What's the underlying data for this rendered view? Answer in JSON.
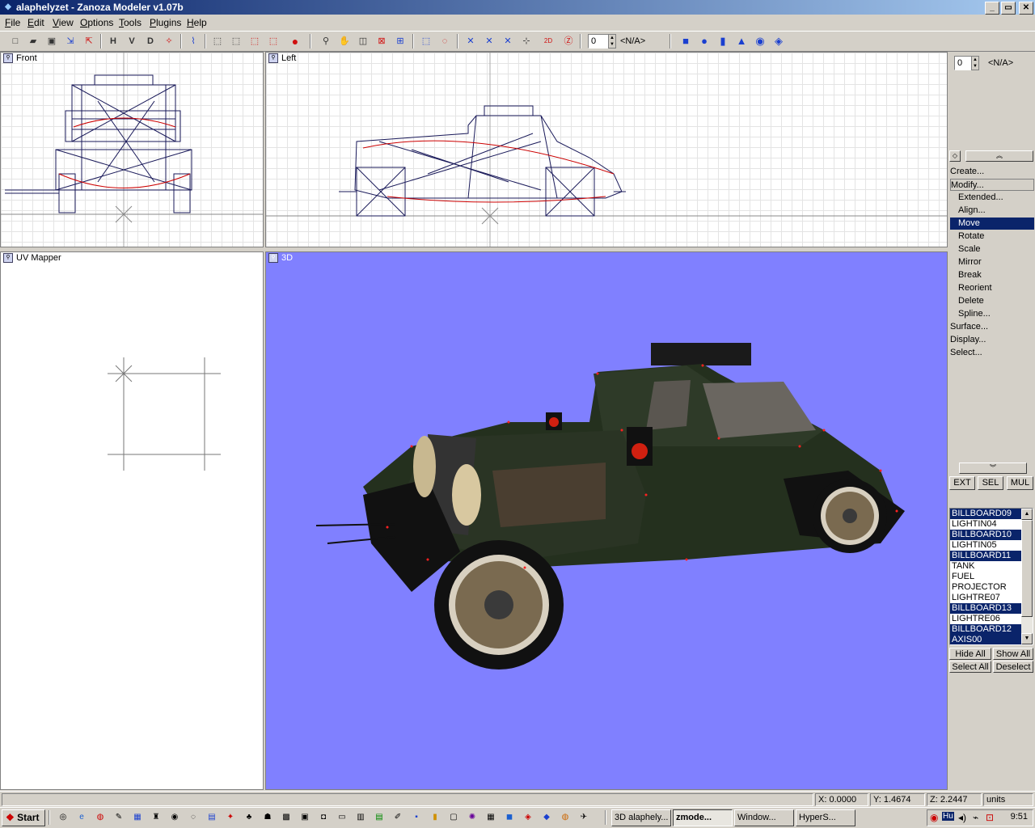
{
  "window": {
    "title": "alaphelyzet - Zanoza Modeler v1.07b",
    "min": "_",
    "max": "▭",
    "close": "✕"
  },
  "menu": [
    "File",
    "Edit",
    "View",
    "Options",
    "Tools",
    "Plugins",
    "Help"
  ],
  "toolbar": {
    "h_label": "H",
    "v_label": "V",
    "d_label": "D",
    "spin_value": "0",
    "nav_value": "<N/A>"
  },
  "viewports": {
    "front": "Front",
    "left": "Left",
    "uv": "UV Mapper",
    "persp": "3D"
  },
  "right_panel": {
    "spin_value": "0",
    "nav_value": "<N/A>",
    "menu": [
      {
        "label": "Create...",
        "sub": false,
        "sel": false,
        "boxed": false
      },
      {
        "label": "Modify...",
        "sub": false,
        "sel": false,
        "boxed": true
      },
      {
        "label": "Extended...",
        "sub": true,
        "sel": false,
        "boxed": false
      },
      {
        "label": "Align...",
        "sub": true,
        "sel": false,
        "boxed": false
      },
      {
        "label": "Move",
        "sub": true,
        "sel": true,
        "boxed": false
      },
      {
        "label": "Rotate",
        "sub": true,
        "sel": false,
        "boxed": false
      },
      {
        "label": "Scale",
        "sub": true,
        "sel": false,
        "boxed": false
      },
      {
        "label": "Mirror",
        "sub": true,
        "sel": false,
        "boxed": false
      },
      {
        "label": "Break",
        "sub": true,
        "sel": false,
        "boxed": false
      },
      {
        "label": "Reorient",
        "sub": true,
        "sel": false,
        "boxed": false
      },
      {
        "label": "Delete",
        "sub": true,
        "sel": false,
        "boxed": false
      },
      {
        "label": "Spline...",
        "sub": true,
        "sel": false,
        "boxed": false
      },
      {
        "label": "Surface...",
        "sub": false,
        "sel": false,
        "boxed": false
      },
      {
        "label": "Display...",
        "sub": false,
        "sel": false,
        "boxed": false
      },
      {
        "label": "Select...",
        "sub": false,
        "sel": false,
        "boxed": false
      }
    ],
    "mode_buttons": [
      "EXT",
      "SEL",
      "MUL"
    ],
    "objects": [
      {
        "name": "BILLBOARD09",
        "sel": true
      },
      {
        "name": "LIGHTIN04",
        "sel": false
      },
      {
        "name": "BILLBOARD10",
        "sel": true
      },
      {
        "name": "LIGHTIN05",
        "sel": false
      },
      {
        "name": "BILLBOARD11",
        "sel": true
      },
      {
        "name": "TANK",
        "sel": false
      },
      {
        "name": "FUEL",
        "sel": false
      },
      {
        "name": "PROJECTOR",
        "sel": false
      },
      {
        "name": "LIGHTRE07",
        "sel": false
      },
      {
        "name": "BILLBOARD13",
        "sel": true
      },
      {
        "name": "LIGHTRE06",
        "sel": false
      },
      {
        "name": "BILLBOARD12",
        "sel": true
      },
      {
        "name": "AXIS00",
        "sel": true
      }
    ],
    "hide_all": "Hide All",
    "show_all": "Show All",
    "select_all": "Select All",
    "deselect": "Deselect"
  },
  "status": {
    "x": "X: 0.0000",
    "y": "Y: 1.4674",
    "z": "Z: 2.2447",
    "units": "units"
  },
  "taskbar": {
    "start": "Start",
    "tasks": [
      {
        "label": "3D alaphely...",
        "active": false
      },
      {
        "label": "zmode...",
        "active": true
      },
      {
        "label": "Window...",
        "active": false
      },
      {
        "label": "HyperS...",
        "active": false
      }
    ],
    "clock": "9:51",
    "lang": "Hu"
  }
}
